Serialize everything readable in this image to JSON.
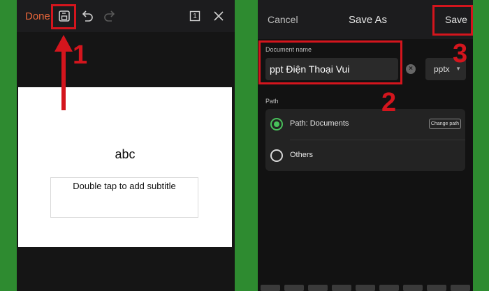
{
  "left": {
    "toolbar": {
      "done_label": "Done",
      "icons": [
        "save-icon",
        "undo-icon",
        "redo-icon",
        "slide-number-icon",
        "close-icon"
      ],
      "slide_number": "1"
    },
    "slide": {
      "title": "abc",
      "subtitle_placeholder": "Double tap to add subtitle"
    },
    "step_label": "1"
  },
  "right": {
    "nav": {
      "cancel_label": "Cancel",
      "title": "Save As",
      "save_label": "Save"
    },
    "document_name": {
      "label": "Document name",
      "value": "ppt Điện Thoại Vui",
      "extension": "pptx"
    },
    "path": {
      "label": "Path",
      "options": [
        {
          "label": "Path: Documents",
          "selected": true,
          "action": "Change path"
        },
        {
          "label": "Others",
          "selected": false
        }
      ]
    },
    "step_labels": [
      "2",
      "3"
    ]
  },
  "colors": {
    "accent_done": "#e8663a",
    "annotation_red": "#d4151d",
    "radio_green": "#48c05a",
    "background_green": "#2e8b30"
  }
}
